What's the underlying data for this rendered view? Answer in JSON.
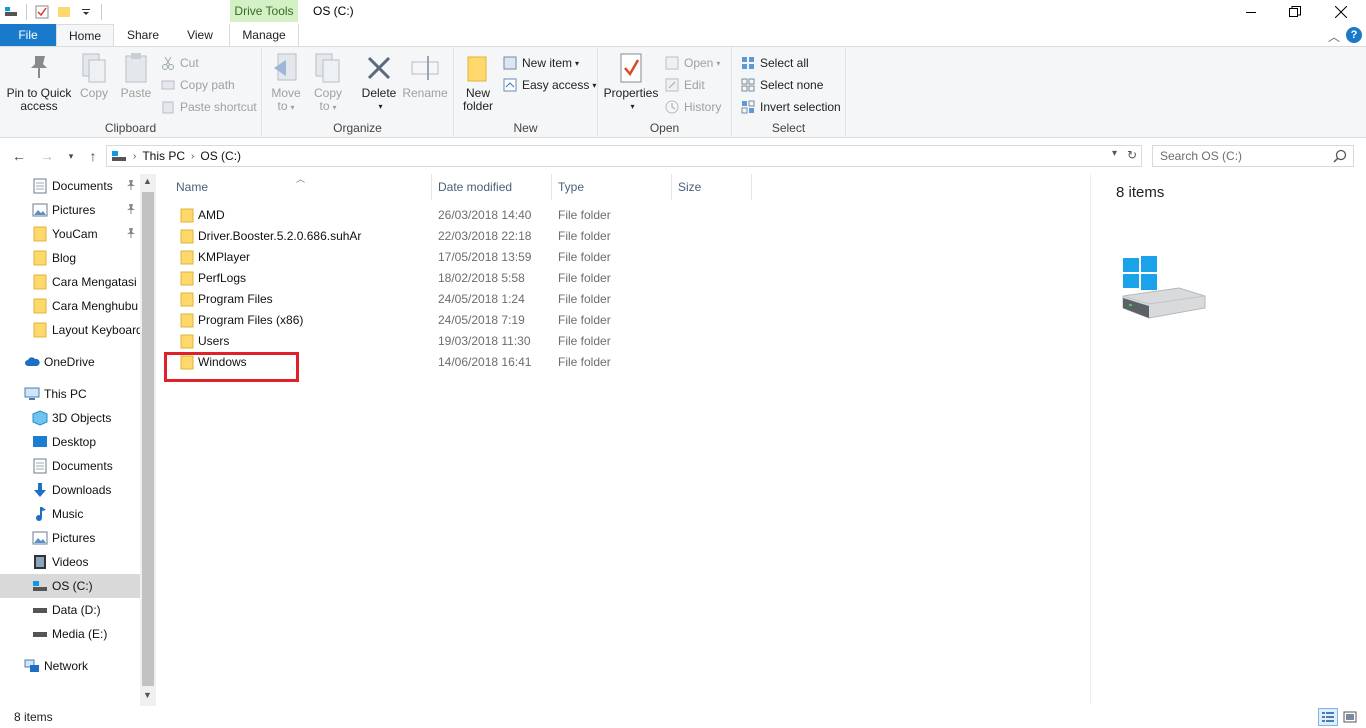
{
  "window": {
    "title": "OS (C:)",
    "context_tab_label": "Drive Tools"
  },
  "tabs": {
    "file": "File",
    "home": "Home",
    "share": "Share",
    "view": "View",
    "manage": "Manage"
  },
  "ribbon": {
    "clipboard": {
      "label": "Clipboard",
      "pin_line1": "Pin to Quick",
      "pin_line2": "access",
      "copy": "Copy",
      "paste": "Paste",
      "cut": "Cut",
      "copy_path": "Copy path",
      "paste_shortcut": "Paste shortcut"
    },
    "organize": {
      "label": "Organize",
      "move_line1": "Move",
      "move_line2": "to",
      "copy_line1": "Copy",
      "copy_line2": "to",
      "delete": "Delete",
      "rename": "Rename"
    },
    "new": {
      "label": "New",
      "new_folder_line1": "New",
      "new_folder_line2": "folder",
      "new_item": "New item",
      "easy_access": "Easy access"
    },
    "open": {
      "label": "Open",
      "properties": "Properties",
      "open": "Open",
      "edit": "Edit",
      "history": "History"
    },
    "select": {
      "label": "Select",
      "select_all": "Select all",
      "select_none": "Select none",
      "invert_selection": "Invert selection"
    }
  },
  "address": {
    "crumbs": [
      "This PC",
      "OS (C:)"
    ],
    "search_placeholder": "Search OS (C:)"
  },
  "nav": {
    "quick_access": [
      {
        "label": "Documents",
        "icon": "documents-icon",
        "pinned": true
      },
      {
        "label": "Pictures",
        "icon": "pictures-icon",
        "pinned": true
      },
      {
        "label": "YouCam",
        "icon": "folder-icon",
        "pinned": true
      },
      {
        "label": "Blog",
        "icon": "folder-icon",
        "pinned": false
      },
      {
        "label": "Cara Mengatasi",
        "icon": "folder-icon",
        "pinned": false
      },
      {
        "label": "Cara Menghubu",
        "icon": "folder-icon",
        "pinned": false
      },
      {
        "label": "Layout Keyboard",
        "icon": "folder-icon",
        "pinned": false
      }
    ],
    "onedrive": "OneDrive",
    "this_pc": "This PC",
    "this_pc_items": [
      {
        "label": "3D Objects",
        "icon": "3d-objects-icon"
      },
      {
        "label": "Desktop",
        "icon": "desktop-icon"
      },
      {
        "label": "Documents",
        "icon": "documents-icon"
      },
      {
        "label": "Downloads",
        "icon": "downloads-icon"
      },
      {
        "label": "Music",
        "icon": "music-icon"
      },
      {
        "label": "Pictures",
        "icon": "pictures-icon"
      },
      {
        "label": "Videos",
        "icon": "videos-icon"
      },
      {
        "label": "OS (C:)",
        "icon": "os-drive-icon"
      },
      {
        "label": "Data (D:)",
        "icon": "drive-icon"
      },
      {
        "label": "Media (E:)",
        "icon": "drive-icon"
      }
    ],
    "network": "Network"
  },
  "columns": {
    "name": "Name",
    "date_modified": "Date modified",
    "type": "Type",
    "size": "Size"
  },
  "files": [
    {
      "name": "AMD",
      "date": "26/03/2018 14:40",
      "type": "File folder"
    },
    {
      "name": "Driver.Booster.5.2.0.686.suhAr",
      "date": "22/03/2018 22:18",
      "type": "File folder"
    },
    {
      "name": "KMPlayer",
      "date": "17/05/2018 13:59",
      "type": "File folder"
    },
    {
      "name": "PerfLogs",
      "date": "18/02/2018 5:58",
      "type": "File folder"
    },
    {
      "name": "Program Files",
      "date": "24/05/2018 1:24",
      "type": "File folder"
    },
    {
      "name": "Program Files (x86)",
      "date": "24/05/2018 7:19",
      "type": "File folder"
    },
    {
      "name": "Users",
      "date": "19/03/2018 11:30",
      "type": "File folder"
    },
    {
      "name": "Windows",
      "date": "14/06/2018 16:41",
      "type": "File folder"
    }
  ],
  "preview": {
    "count": "8 items"
  },
  "status": {
    "text": "8 items"
  },
  "colors": {
    "accent": "#1979ca",
    "folder": "#ffd86b",
    "highlight": "#e0202a"
  }
}
